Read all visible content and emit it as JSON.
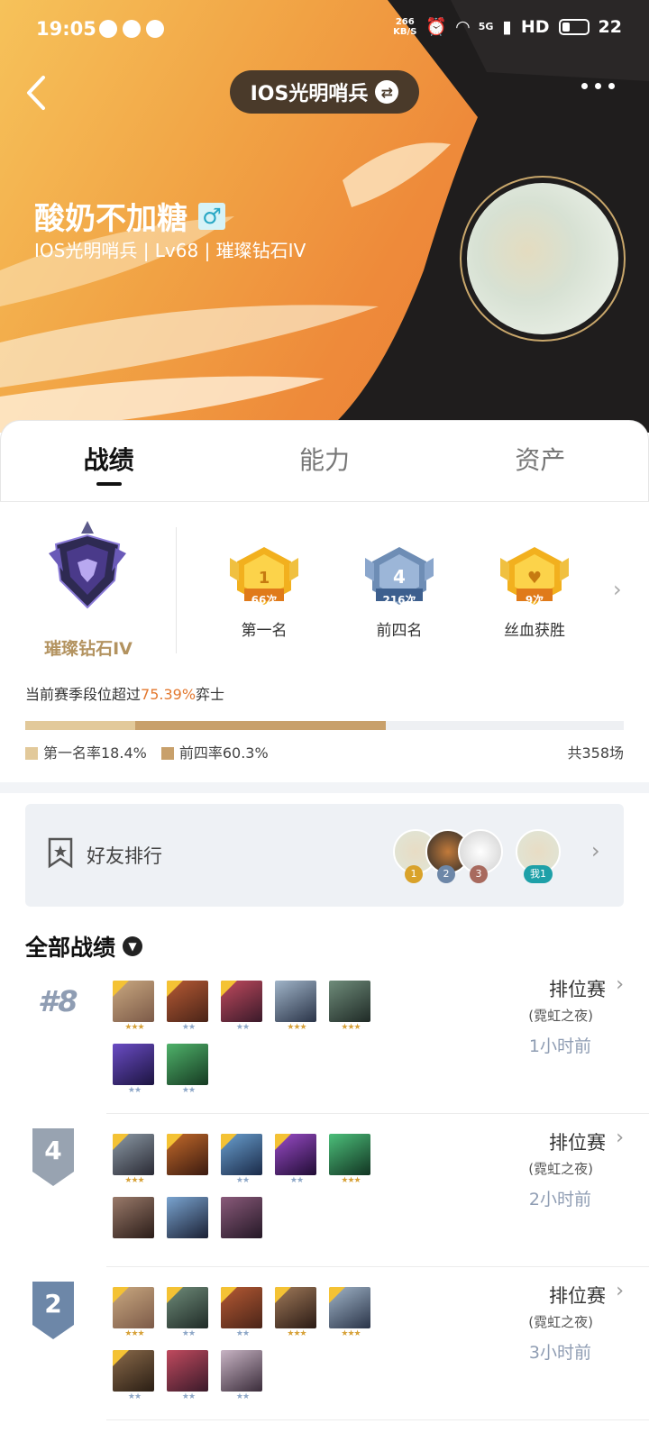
{
  "status_bar": {
    "time": "19:05",
    "net_speed_value": "266",
    "net_speed_unit": "KB/S",
    "signal": "5G",
    "hd": "HD",
    "battery": "22"
  },
  "header": {
    "server_pill": "IOS光明哨兵",
    "player_name": "酸奶不加糖",
    "gender_symbol": "♂",
    "meta": "IOS光明哨兵 | Lv68 | 璀璨钻石IV"
  },
  "tabs": [
    "战绩",
    "能力",
    "资产"
  ],
  "rank": {
    "name": "璀璨钻石IV",
    "badges": [
      {
        "label": "第一名",
        "count": "66次",
        "icon": "1",
        "color": "gold"
      },
      {
        "label": "前四名",
        "count": "216次",
        "icon": "4",
        "color": "blue"
      },
      {
        "label": "丝血获胜",
        "count": "9次",
        "icon": "heart",
        "color": "gold"
      }
    ],
    "exceed_prefix": "当前赛季段位超过",
    "exceed_percent": "75.39%",
    "exceed_suffix": "弈士",
    "first_rate_label": "第一名率18.4%",
    "top4_rate_label": "前四率60.3%",
    "first_rate": 0.184,
    "top4_rate": 0.603,
    "total": "共358场"
  },
  "friends": {
    "title": "好友排行",
    "ranks": [
      "1",
      "2",
      "3"
    ],
    "me": "我1"
  },
  "records_title": "全部战绩",
  "matches": [
    {
      "place": "#8",
      "place_style": "text",
      "type": "排位赛",
      "sub": "(霓虹之夜)",
      "time": "1小时前",
      "units": [
        {
          "stars": "★★★",
          "star_color": "gold",
          "item": true,
          "c1": "#c9a880",
          "c2": "#7c5a48"
        },
        {
          "stars": "★★",
          "star_color": "silver",
          "item": true,
          "c1": "#b65a34",
          "c2": "#4a2418"
        },
        {
          "stars": "★★",
          "star_color": "silver",
          "item": true,
          "c1": "#c04a5e",
          "c2": "#3a1a2a"
        },
        {
          "stars": "★★★",
          "star_color": "gold",
          "item": false,
          "c1": "#a0b4c8",
          "c2": "#2a3448"
        },
        {
          "stars": "★★★",
          "star_color": "gold",
          "item": false,
          "c1": "#6f8c7a",
          "c2": "#1f2a26"
        },
        {
          "stars": "★★",
          "star_color": "silver",
          "item": false,
          "c1": "#6a4cc4",
          "c2": "#1c1440"
        },
        {
          "stars": "★★",
          "star_color": "silver",
          "item": false,
          "c1": "#4fb26a",
          "c2": "#163a22"
        }
      ]
    },
    {
      "place": "4",
      "place_style": "flag",
      "flag_color": "#98a3b1",
      "type": "排位赛",
      "sub": "(霓虹之夜)",
      "time": "2小时前",
      "units": [
        {
          "stars": "★★★",
          "star_color": "gold",
          "item": true,
          "c1": "#8c9aa6",
          "c2": "#2a2a34"
        },
        {
          "stars": "",
          "star_color": "gold",
          "item": true,
          "c1": "#c46a2a",
          "c2": "#3a1a10"
        },
        {
          "stars": "★★",
          "star_color": "silver",
          "item": true,
          "c1": "#6aa0d0",
          "c2": "#1a2a48"
        },
        {
          "stars": "★★",
          "star_color": "silver",
          "item": true,
          "c1": "#9a4cc8",
          "c2": "#200c34"
        },
        {
          "stars": "★★★",
          "star_color": "gold",
          "item": false,
          "c1": "#4cbf7a",
          "c2": "#123422"
        },
        {
          "stars": "",
          "star_color": "silver",
          "item": false,
          "c1": "#9a7a6a",
          "c2": "#2a1c18"
        },
        {
          "stars": "",
          "star_color": "silver",
          "item": false,
          "c1": "#7aa4d0",
          "c2": "#1a2034"
        },
        {
          "stars": "",
          "star_color": "silver",
          "item": false,
          "c1": "#8a5a7a",
          "c2": "#241826"
        }
      ]
    },
    {
      "place": "2",
      "place_style": "flag",
      "flag_color": "#6d87a8",
      "type": "排位赛",
      "sub": "(霓虹之夜)",
      "time": "3小时前",
      "units": [
        {
          "stars": "★★★",
          "star_color": "gold",
          "item": true,
          "c1": "#c9a880",
          "c2": "#7c5a48"
        },
        {
          "stars": "★★",
          "star_color": "silver",
          "item": true,
          "c1": "#6f8c7a",
          "c2": "#1f2a26"
        },
        {
          "stars": "★★",
          "star_color": "silver",
          "item": true,
          "c1": "#b65a34",
          "c2": "#4a2418"
        },
        {
          "stars": "★★★",
          "star_color": "gold",
          "item": true,
          "c1": "#a07a5a",
          "c2": "#2a1a14"
        },
        {
          "stars": "★★★",
          "star_color": "gold",
          "item": true,
          "c1": "#a0b4c8",
          "c2": "#2a3448"
        },
        {
          "stars": "★★",
          "star_color": "silver",
          "item": true,
          "c1": "#8a6a4a",
          "c2": "#2a1e14"
        },
        {
          "stars": "★★",
          "star_color": "silver",
          "item": false,
          "c1": "#c04a5e",
          "c2": "#3a1a2a"
        },
        {
          "stars": "★★",
          "star_color": "silver",
          "item": false,
          "c1": "#c8b4c4",
          "c2": "#3a2c3a"
        }
      ]
    }
  ]
}
